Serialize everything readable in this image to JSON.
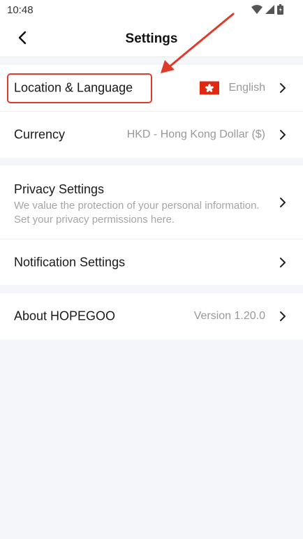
{
  "status": {
    "time": "10:48",
    "icons": [
      "wifi-icon",
      "signal-icon",
      "battery-icon"
    ]
  },
  "header": {
    "title": "Settings",
    "back_icon": "chevron-left-icon"
  },
  "group1": {
    "location": {
      "label": "Location & Language",
      "value": "English",
      "flag": "hong-kong-flag-icon"
    },
    "currency": {
      "label": "Currency",
      "value": "HKD - Hong Kong Dollar ($)"
    }
  },
  "group2": {
    "privacy": {
      "label": "Privacy Settings",
      "description": "We value the protection of your personal information. Set your privacy permissions here."
    },
    "notification": {
      "label": "Notification Settings"
    }
  },
  "group3": {
    "about": {
      "label": "About HOPEGOO",
      "value": "Version 1.20.0"
    }
  },
  "annotation": {
    "color": "#e03b2a"
  }
}
